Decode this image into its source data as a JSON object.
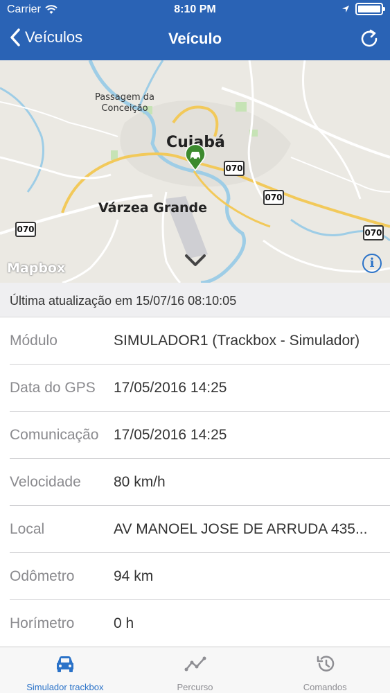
{
  "status_bar": {
    "carrier": "Carrier",
    "time": "8:10 PM"
  },
  "nav": {
    "back_label": "Veículos",
    "title": "Veículo"
  },
  "map": {
    "labels": {
      "passagem": "Passagem da\nConceição",
      "cuiaba": "Cuiabá",
      "varzea": "Várzea Grande"
    },
    "shields": [
      "070",
      "070",
      "070",
      "070"
    ],
    "logo": "Mapbox",
    "info": "i"
  },
  "last_update": "Última atualização em 15/07/16 08:10:05",
  "details": [
    {
      "label": "Módulo",
      "value": "SIMULADOR1 (Trackbox - Simulador)"
    },
    {
      "label": "Data do GPS",
      "value": "17/05/2016 14:25"
    },
    {
      "label": "Comunicação",
      "value": "17/05/2016 14:25"
    },
    {
      "label": "Velocidade",
      "value": "80 km/h"
    },
    {
      "label": "Local",
      "value": "AV MANOEL JOSE DE ARRUDA 435..."
    },
    {
      "label": "Odômetro",
      "value": "94 km"
    },
    {
      "label": "Horímetro",
      "value": "0 h"
    }
  ],
  "tabs": [
    {
      "label": "Simulador trackbox",
      "icon": "car-icon",
      "active": true
    },
    {
      "label": "Percurso",
      "icon": "route-icon",
      "active": false
    },
    {
      "label": "Comandos",
      "icon": "history-icon",
      "active": false
    }
  ],
  "colors": {
    "header": "#2a63b5",
    "accent": "#2a72c8",
    "marker": "#3c8a2e"
  }
}
